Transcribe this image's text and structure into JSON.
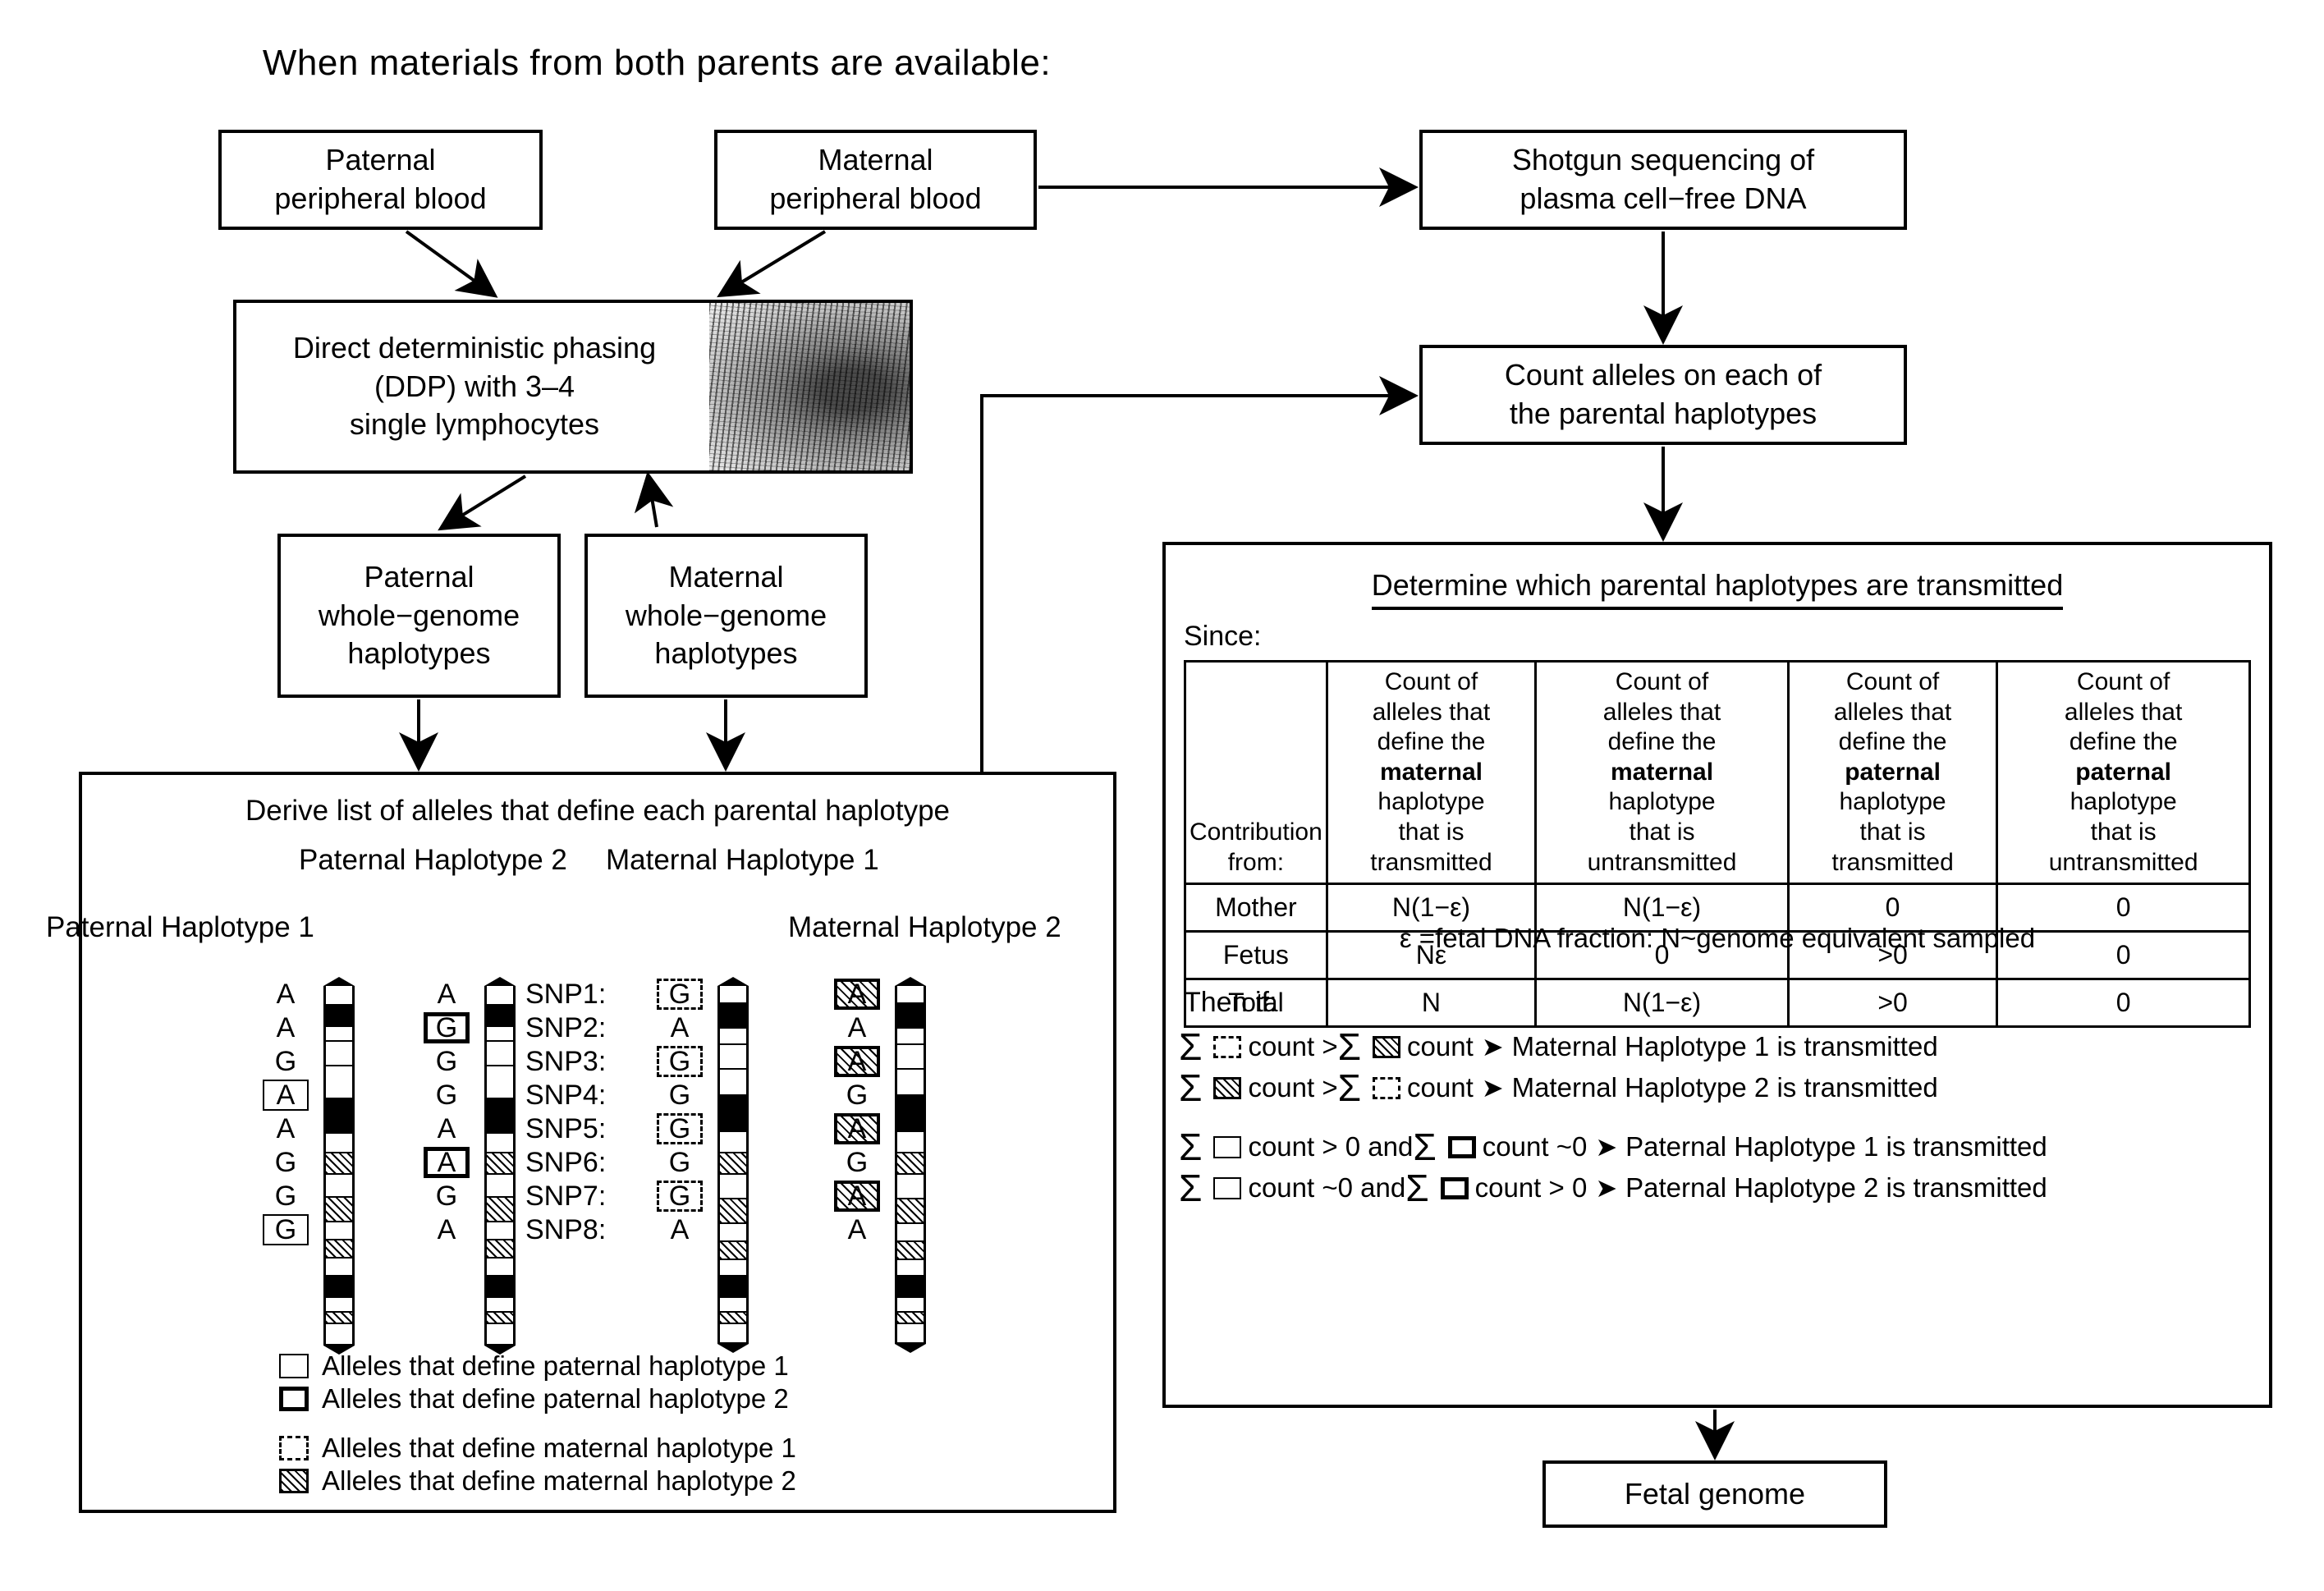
{
  "title": "When materials from both parents are available:",
  "boxes": {
    "paternal_blood": [
      "Paternal",
      "peripheral blood"
    ],
    "maternal_blood": [
      "Maternal",
      "peripheral blood"
    ],
    "ddp": [
      "Direct deterministic phasing",
      "(DDP) with 3–4",
      "single lymphocytes"
    ],
    "paternal_wg": [
      "Paternal",
      "whole−genome",
      "haplotypes"
    ],
    "maternal_wg": [
      "Maternal",
      "whole−genome",
      "haplotypes"
    ],
    "shotgun": [
      "Shotgun sequencing of",
      "plasma cell−free DNA"
    ],
    "count_alleles": [
      "Count alleles on each of",
      "the parental haplotypes"
    ],
    "fetal_genome": [
      "Fetal genome"
    ]
  },
  "left_panel": {
    "title": "Derive list of alleles that define each parental haplotype",
    "labels": {
      "paternal_hap1": "Paternal Haplotype 1",
      "paternal_hap2": "Paternal Haplotype 2",
      "maternal_hap1": "Maternal Haplotype 1",
      "maternal_hap2": "Maternal Haplotype 2"
    },
    "snp_labels": [
      "SNP1:",
      "SNP2:",
      "SNP3:",
      "SNP4:",
      "SNP5:",
      "SNP6:",
      "SNP7:",
      "SNP8:"
    ],
    "alleles": {
      "paternal_hap1": [
        {
          "base": "A",
          "box": "none"
        },
        {
          "base": "A",
          "box": "none"
        },
        {
          "base": "G",
          "box": "none"
        },
        {
          "base": "A",
          "box": "thin"
        },
        {
          "base": "A",
          "box": "none"
        },
        {
          "base": "G",
          "box": "none"
        },
        {
          "base": "G",
          "box": "none"
        },
        {
          "base": "G",
          "box": "thin"
        }
      ],
      "paternal_hap2": [
        {
          "base": "A",
          "box": "none"
        },
        {
          "base": "G",
          "box": "thick"
        },
        {
          "base": "G",
          "box": "none"
        },
        {
          "base": "G",
          "box": "none"
        },
        {
          "base": "A",
          "box": "none"
        },
        {
          "base": "A",
          "box": "thick"
        },
        {
          "base": "G",
          "box": "none"
        },
        {
          "base": "A",
          "box": "none"
        }
      ],
      "maternal_hap1": [
        {
          "base": "G",
          "box": "dash"
        },
        {
          "base": "A",
          "box": "none"
        },
        {
          "base": "G",
          "box": "dash"
        },
        {
          "base": "G",
          "box": "none"
        },
        {
          "base": "G",
          "box": "dash"
        },
        {
          "base": "G",
          "box": "none"
        },
        {
          "base": "G",
          "box": "dash"
        },
        {
          "base": "A",
          "box": "none"
        }
      ],
      "maternal_hap2": [
        {
          "base": "A",
          "box": "hatch"
        },
        {
          "base": "A",
          "box": "none"
        },
        {
          "base": "A",
          "box": "hatch"
        },
        {
          "base": "G",
          "box": "none"
        },
        {
          "base": "A",
          "box": "hatch"
        },
        {
          "base": "G",
          "box": "none"
        },
        {
          "base": "A",
          "box": "hatch"
        },
        {
          "base": "A",
          "box": "none"
        }
      ]
    },
    "legend": [
      {
        "swatch": "thin",
        "text": "Alleles that define paternal haplotype 1"
      },
      {
        "swatch": "thick",
        "text": "Alleles that define paternal haplotype 2"
      },
      {
        "swatch": "dash",
        "text": "Alleles that define maternal haplotype 1"
      },
      {
        "swatch": "hatch",
        "text": "Alleles that define maternal haplotype 2"
      }
    ]
  },
  "right_panel": {
    "title": "Determine which parental haplotypes are transmitted",
    "since_label": "Since:",
    "table": {
      "corner_header": [
        "Contribution",
        "from:"
      ],
      "headers": [
        {
          "lines": [
            "Count of",
            "alleles that",
            "define the",
            "maternal",
            "haplotype",
            "that is",
            "transmitted"
          ],
          "bold_line_index": 3
        },
        {
          "lines": [
            "Count of",
            "alleles that",
            "define the",
            "maternal",
            "haplotype",
            "that is",
            "untransmitted"
          ],
          "bold_line_index": 3
        },
        {
          "lines": [
            "Count of",
            "alleles that",
            "define the",
            "paternal",
            "haplotype",
            "that is",
            "transmitted"
          ],
          "bold_line_index": 3
        },
        {
          "lines": [
            "Count of",
            "alleles that",
            "define the",
            "paternal",
            "haplotype",
            "that is",
            "untransmitted"
          ],
          "bold_line_index": 3
        }
      ],
      "rows": [
        {
          "label": "Mother",
          "values": [
            "N(1−ε)",
            "N(1−ε)",
            "0",
            "0"
          ]
        },
        {
          "label": "Fetus",
          "values": [
            "Nε",
            "0",
            ">0",
            "0"
          ]
        },
        {
          "label": "Total",
          "values": [
            "N",
            "N(1−ε)",
            ">0",
            "0"
          ]
        }
      ]
    },
    "epsilon_note": "ε =fetal DNA fraction: N~genome equivalent sampled",
    "then_if_label": "Then if:",
    "rules": [
      {
        "sym1": "dash",
        "op1": "count >",
        "sym2": "hatch",
        "op2": "count",
        "result": "Maternal Haplotype 1 is transmitted"
      },
      {
        "sym1": "hatch",
        "op1": "count >",
        "sym2": "dash",
        "op2": "count",
        "result": "Maternal Haplotype 2 is transmitted"
      },
      {
        "sym1": "thin",
        "op1": "count > 0 and",
        "sym2": "thick",
        "op2": "count ~0",
        "result": "Paternal Haplotype 1 is transmitted"
      },
      {
        "sym1": "thin",
        "op1": "count ~0 and",
        "sym2": "thick",
        "op2": "count > 0",
        "result": "Paternal Haplotype 2 is transmitted"
      }
    ],
    "sum_symbol": "Σ",
    "arrow_symbol": "➤"
  },
  "colors": {
    "ink": "#000000",
    "paper": "#ffffff"
  }
}
